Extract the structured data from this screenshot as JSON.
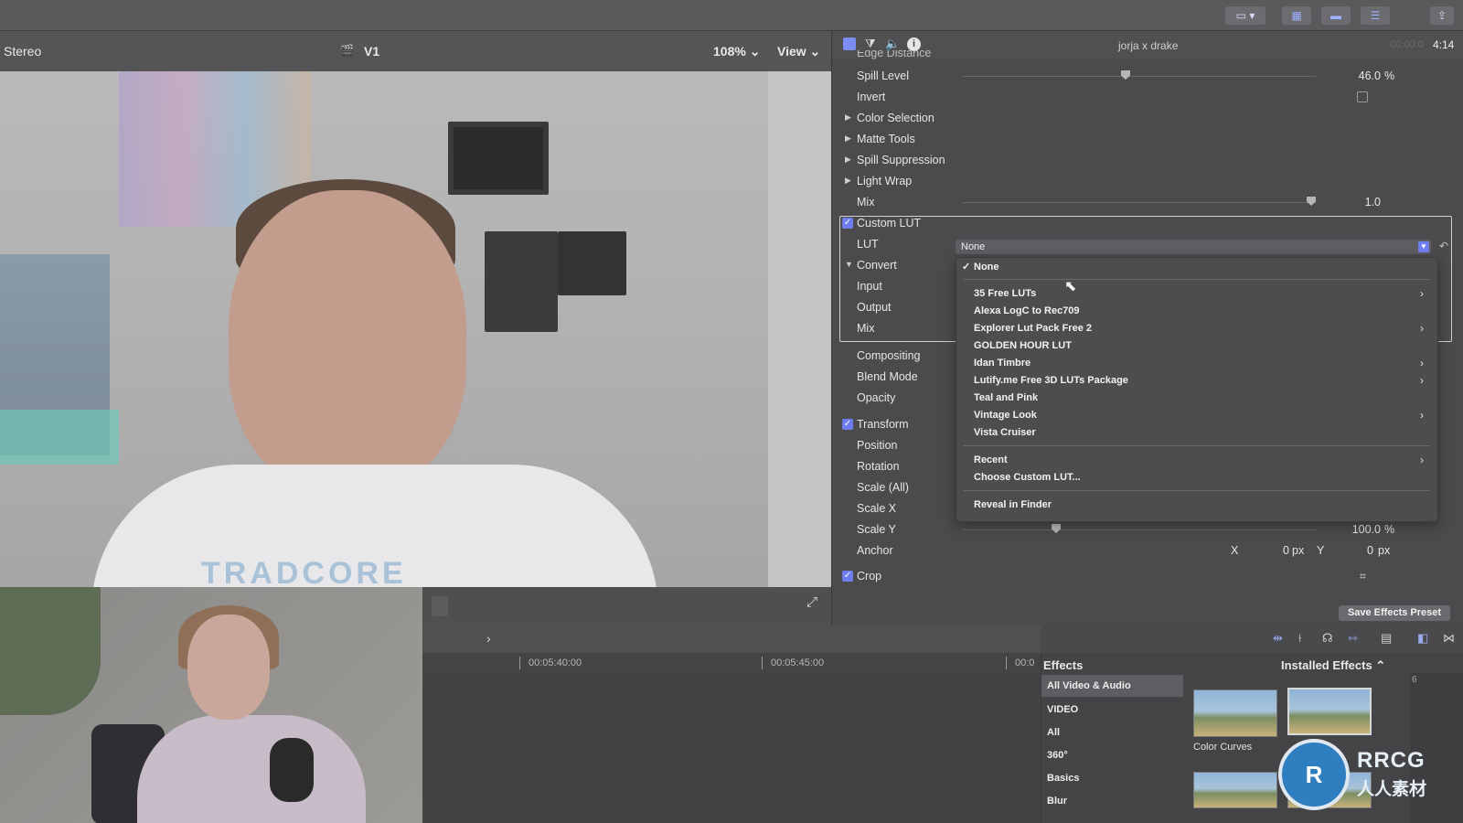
{
  "viewer": {
    "audio_label": "Stereo",
    "angle_label": "V1",
    "zoom_label": "108%",
    "view_label": "View"
  },
  "video": {
    "shirt_text": "TRADCORE"
  },
  "inspector": {
    "clip_name": "jorja x drake",
    "timecode_dim": "00:00:0",
    "timecode": "4:14",
    "partial_top_label": "Edge Distance",
    "spill_level_label": "Spill Level",
    "spill_level_value": "46.0",
    "spill_level_unit": "%",
    "invert_label": "Invert",
    "color_selection_label": "Color Selection",
    "matte_tools_label": "Matte Tools",
    "spill_suppression_label": "Spill Suppression",
    "light_wrap_label": "Light Wrap",
    "mix_label": "Mix",
    "mix_value": "1.0",
    "custom_lut_label": "Custom LUT",
    "lut_label": "LUT",
    "lut_selected": "None",
    "convert_label": "Convert",
    "input_label": "Input",
    "output_label": "Output",
    "convert_mix_label": "Mix",
    "compositing_label": "Compositing",
    "blend_mode_label": "Blend Mode",
    "opacity_label": "Opacity",
    "transform_label": "Transform",
    "position_label": "Position",
    "rotation_label": "Rotation",
    "scale_all_label": "Scale (All)",
    "scale_x_label": "Scale X",
    "scale_y_label": "Scale Y",
    "scale_y_value": "100.0",
    "scale_y_unit": "%",
    "anchor_label": "Anchor",
    "anchor_x_label": "X",
    "anchor_x_value": "0",
    "anchor_y_label": "Y",
    "anchor_y_value": "0",
    "px_unit": "px",
    "crop_label": "Crop",
    "save_preset_label": "Save Effects Preset"
  },
  "lut_menu": {
    "items": [
      {
        "label": "None",
        "checked": true
      },
      {
        "label": "35 Free LUTs",
        "submenu": true
      },
      {
        "label": "Alexa LogC to Rec709"
      },
      {
        "label": "Explorer Lut Pack Free 2",
        "submenu": true
      },
      {
        "label": "GOLDEN HOUR LUT"
      },
      {
        "label": "Idan Timbre",
        "submenu": true
      },
      {
        "label": "Lutify.me Free 3D LUTs Package",
        "submenu": true
      },
      {
        "label": "Teal and Pink"
      },
      {
        "label": "Vintage Look",
        "submenu": true
      },
      {
        "label": "Vista Cruiser"
      },
      {
        "label": "Recent",
        "submenu": true
      },
      {
        "label": "Choose Custom LUT..."
      },
      {
        "label": "Reveal in Finder"
      }
    ],
    "checkmark": "✓",
    "submenu_arrow": "›"
  },
  "timeline": {
    "ruler": [
      "00:05:40:00",
      "00:05:45:00",
      "00:0"
    ]
  },
  "effects": {
    "title": "Effects",
    "installed_label": "Installed Effects",
    "categories": [
      "All Video & Audio",
      "VIDEO",
      "All",
      "360°",
      "Basics",
      "Blur"
    ],
    "thumb_labels": [
      "Color Curves"
    ],
    "meter_label": "6"
  },
  "watermark": {
    "logo_text": "RRCG",
    "logo_sub": "人人素材"
  },
  "colors": {
    "accent": "#6e7ef0",
    "panel": "#4b4b4d"
  }
}
